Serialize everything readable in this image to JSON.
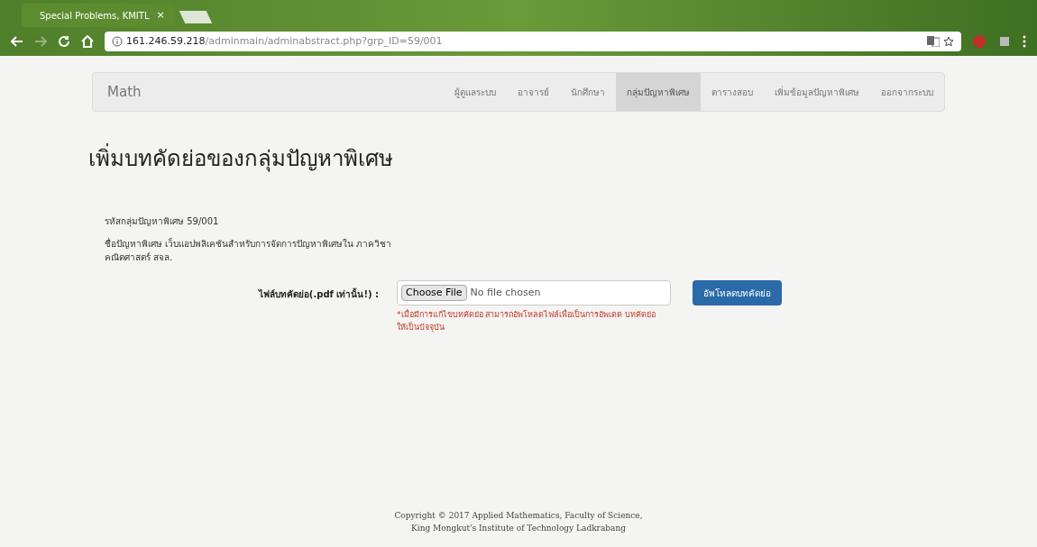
{
  "browser": {
    "tab_title": "Special Problems, KMITL",
    "tab_close": "×",
    "url_host": "161.246.59.218",
    "url_path": "/adminmain/adminabstract.php?grp_ID=59/001"
  },
  "navbar": {
    "brand": "Math",
    "items": [
      {
        "label": "ผู้ดูแลระบบ",
        "selected": false
      },
      {
        "label": "อาจารย์",
        "selected": false
      },
      {
        "label": "นักศึกษา",
        "selected": false
      },
      {
        "label": "กลุ่มปัญหาพิเศษ",
        "selected": true
      },
      {
        "label": "ตารางสอบ",
        "selected": false
      },
      {
        "label": "เพิ่มข้อมูลปัญหาพิเศษ",
        "selected": false
      },
      {
        "label": "ออกจากระบบ",
        "selected": false
      }
    ]
  },
  "heading": "เพิ่มบทคัดย่อของกลุ่มปัญหาพิเศษ",
  "info": [
    "รหัสกลุ่มปัญหาพิเศษ 59/001",
    "ชื่อปัญหาพิเศษ เว็บแอปพลิเคชันสำหรับการจัดการปัญหาพิเศษใน ภาควิชาคณิตศาสตร์ สจล."
  ],
  "upload": {
    "label": "ไฟล์บทคัดย่อ(.pdf เท่านั้น!) :",
    "choose_button": "Choose File",
    "file_status": "No file chosen",
    "submit": "อัพโหลดบทคัดย่อ",
    "note": "*เมื่อมีการแก้ไขบทคัดย่อ สามารถอัพโหลดไฟล์เพื่อเป็นการอัพเดต บทคัดย่อให้เป็นปัจจุบัน"
  },
  "footer": [
    "Copyright © 2017 Applied Mathematics, Faculty of Science,",
    "King Mongkut's Institute of Technology Ladkrabang"
  ]
}
